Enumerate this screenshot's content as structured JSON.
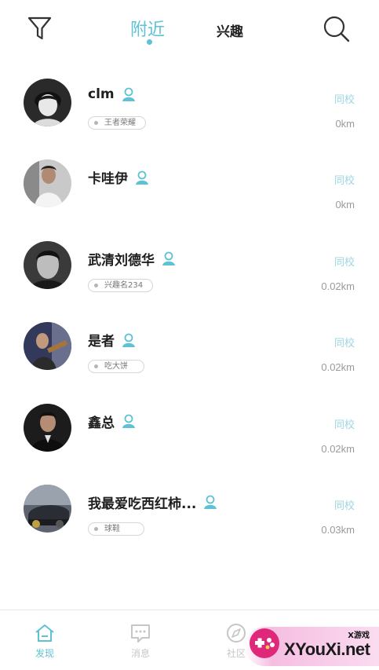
{
  "header": {
    "tab_nearby": "附近",
    "tab_interest": "兴趣",
    "icons": {
      "filter": "filter-icon",
      "search": "search-icon"
    },
    "accent_color": "#5ec2d6"
  },
  "users": [
    {
      "name": "clm",
      "tag": "王者荣耀",
      "school": "同校",
      "distance": "0km",
      "avatar": "avatar-sketch"
    },
    {
      "name": "卡哇伊",
      "tag": "",
      "school": "同校",
      "distance": "0km",
      "avatar": "avatar-white-shirt"
    },
    {
      "name": "武清刘德华",
      "tag": "兴趣名234",
      "school": "同校",
      "distance": "0.02km",
      "avatar": "avatar-bw-portrait"
    },
    {
      "name": "是者",
      "tag": "吃大饼",
      "school": "同校",
      "distance": "0.02km",
      "avatar": "avatar-guitar"
    },
    {
      "name": "鑫总",
      "tag": "",
      "school": "同校",
      "distance": "0.02km",
      "avatar": "avatar-dark-suit"
    },
    {
      "name": "我最爱吃西红柿...",
      "tag": "球鞋",
      "school": "同校",
      "distance": "0.03km",
      "avatar": "avatar-car"
    }
  ],
  "bottom_nav": [
    {
      "label": "发现",
      "icon": "home-icon",
      "active": true
    },
    {
      "label": "消息",
      "icon": "message-icon",
      "active": false
    },
    {
      "label": "社区",
      "icon": "compass-icon",
      "active": false
    }
  ],
  "watermark": {
    "small": "X游戏",
    "big": "XYouXi.net"
  }
}
